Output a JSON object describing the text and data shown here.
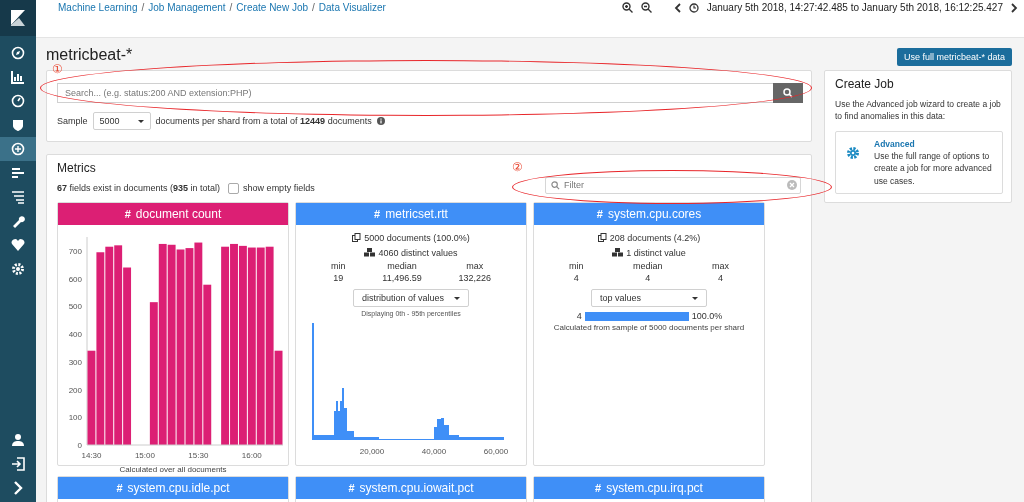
{
  "sidebar": {
    "items": [
      {
        "selected": false
      },
      {
        "selected": false
      },
      {
        "selected": false
      },
      {
        "selected": false
      },
      {
        "selected": true
      },
      {
        "selected": false
      },
      {
        "selected": false
      },
      {
        "selected": false
      },
      {
        "selected": false
      },
      {
        "selected": false
      }
    ]
  },
  "breadcrumbs": [
    "Machine Learning",
    "Job Management",
    "Create New Job",
    "Data Visualizer"
  ],
  "breadcrumb_separator": "/",
  "time_range": "January 5th 2018, 14:27:42.485 to January 5th 2018, 16:12:25.427",
  "page_title": "metricbeat-*",
  "full_data_button": "Use full metricbeat-* data",
  "search": {
    "placeholder": "Search... (e.g. status:200 AND extension:PHP)"
  },
  "sample": {
    "label": "Sample",
    "value": "5000",
    "text": "documents per shard from a total of **12449** documents"
  },
  "annotations": [
    {
      "mark": "①"
    },
    {
      "mark": "②"
    }
  ],
  "metrics": {
    "title": "Metrics",
    "summary": "**67** fields exist in documents (**935** in total)",
    "show_empty": {
      "label": "show empty fields",
      "checked": false
    },
    "filter": {
      "placeholder": "Filter"
    },
    "cards": [
      {
        "kind": "document_count",
        "type_icon": "#",
        "name": "document count",
        "color": "#dc1f74",
        "caption": "Calculated over all documents",
        "chart_data": {
          "type": "bar",
          "x": [
            870,
            875,
            880,
            885,
            890,
            905,
            910,
            915,
            920,
            925,
            930,
            935,
            945,
            950,
            955,
            960,
            965,
            970,
            975
          ],
          "xlim": [
            867.5,
            977.5
          ],
          "values": [
            340,
            695,
            715,
            720,
            640,
            515,
            725,
            722,
            705,
            710,
            730,
            578,
            715,
            725,
            718,
            712,
            712,
            715,
            340
          ],
          "ylim": [
            0,
            750
          ],
          "yticks": [
            0,
            100,
            200,
            300,
            400,
            500,
            600,
            700
          ],
          "xticks": [
            {
              "value": 870,
              "label": "14:30"
            },
            {
              "value": 900,
              "label": "15:00"
            },
            {
              "value": 930,
              "label": "15:30"
            },
            {
              "value": 960,
              "label": "16:00"
            }
          ]
        }
      },
      {
        "kind": "distribution",
        "type_icon": "#",
        "name": "metricset.rtt",
        "color": "#3f8ff7",
        "documents": "5000 documents (100.0%)",
        "distinct": "4060 distinct values",
        "stats": [
          {
            "label": "min",
            "value": "19"
          },
          {
            "label": "median",
            "value": "11,496.59"
          },
          {
            "label": "max",
            "value": "132,226"
          }
        ],
        "select": "distribution of values",
        "note": "Displaying 0th - 95th percentiles",
        "x_labels": [
          "20,000",
          "40,000",
          "60,000"
        ]
      },
      {
        "kind": "top_values",
        "type_icon": "#",
        "name": "system.cpu.cores",
        "color": "#3f8ff7",
        "documents": "208 documents (4.2%)",
        "distinct": "1 distinct value",
        "stats": [
          {
            "label": "min",
            "value": "4"
          },
          {
            "label": "median",
            "value": "4"
          },
          {
            "label": "max",
            "value": "4"
          }
        ],
        "select": "top values",
        "top": [
          {
            "value": "4",
            "level": 1.0,
            "percent": "100.0%"
          }
        ],
        "caption": "Calculated from sample of 5000 documents per shard"
      },
      {
        "kind": "header_only",
        "type_icon": "#",
        "name": "system.cpu.idle.pct",
        "color": "#3f8ff7"
      },
      {
        "kind": "header_only",
        "type_icon": "#",
        "name": "system.cpu.iowait.pct",
        "color": "#3f8ff7"
      },
      {
        "kind": "header_only",
        "type_icon": "#",
        "name": "system.cpu.irq.pct",
        "color": "#3f8ff7"
      }
    ]
  },
  "create_job": {
    "title": "Create Job",
    "description": "Use the Advanced job wizard to create a job to find anomalies in this data:",
    "option": {
      "title": "Advanced",
      "description": "Use the full range of options to create a job for more advanced use cases."
    }
  }
}
